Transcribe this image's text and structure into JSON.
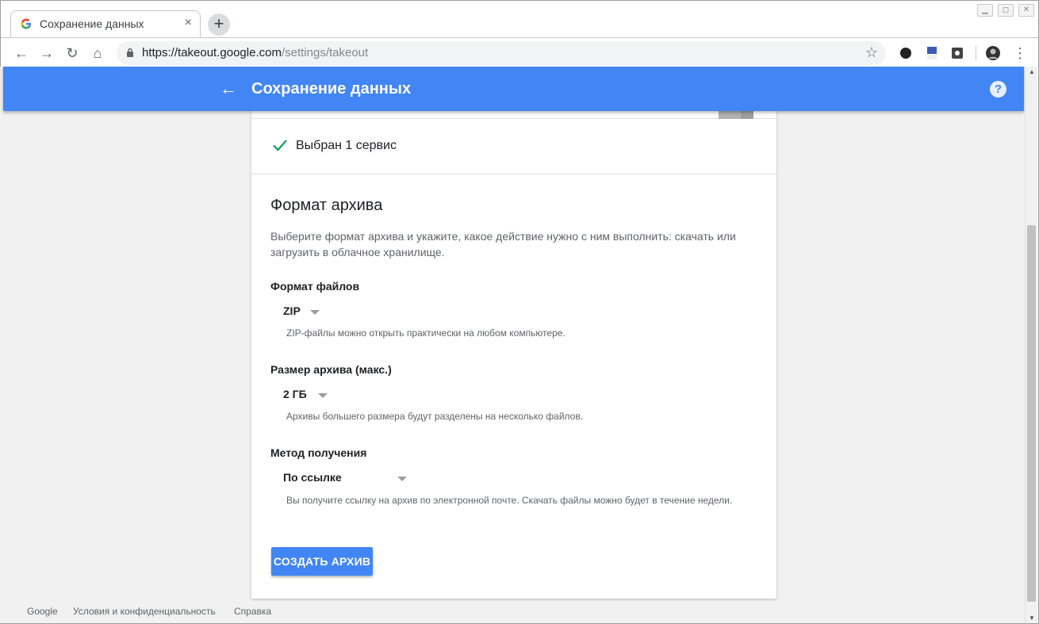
{
  "browser": {
    "tab_title": "Сохранение данных",
    "tab_close": "×",
    "new_tab": "+",
    "url_host": "https://takeout.google.com",
    "url_path": "/settings/takeout",
    "star": "☆",
    "back": "←",
    "forward": "→",
    "reload": "↻",
    "home": "⌂",
    "menu": "⋮",
    "window_controls": [
      "▁",
      "◻",
      "✕"
    ]
  },
  "appbar": {
    "title": "Сохранение данных",
    "back": "←",
    "help": "?"
  },
  "selection": {
    "label": "Выбран 1 сервис"
  },
  "archive": {
    "title": "Формат архива",
    "description": "Выберите формат архива и укажите, какое действие нужно с ним выполнить: скачать или загрузить в облачное хранилище.",
    "file_format": {
      "label": "Формат файлов",
      "value": "ZIP",
      "hint": "ZIP-файлы можно открыть практически на любом компьютере."
    },
    "archive_size": {
      "label": "Размер архива (макс.)",
      "value": "2 ГБ",
      "hint": "Архивы большего размера будут разделены на несколько файлов."
    },
    "delivery": {
      "label": "Метод получения",
      "value": "По ссылке",
      "hint": "Вы получите ссылку на архив по электронной почте. Скачать файлы можно будет в течение недели."
    },
    "create_button": "СОЗДАТЬ АРХИВ"
  },
  "footer": {
    "links": [
      "Google",
      "Условия и конфиденциальность",
      "Справка"
    ]
  },
  "colors": {
    "brand_blue": "#4285f4",
    "check_green": "#0f9d58"
  }
}
